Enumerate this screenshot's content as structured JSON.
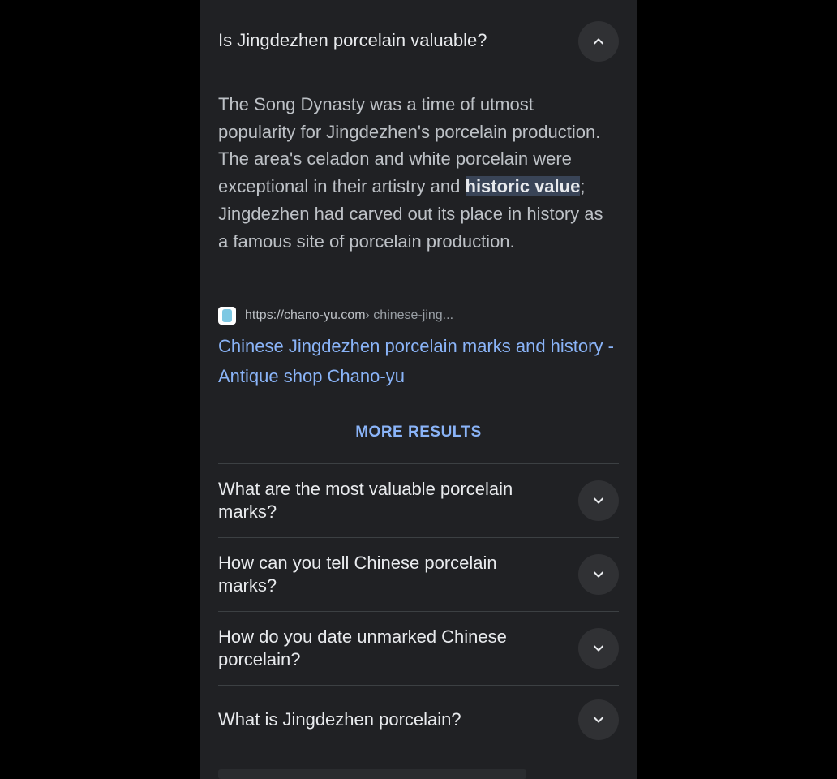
{
  "expanded_question": {
    "title": "Is Jingdezhen porcelain valuable?",
    "answer_before": "The Song Dynasty was a time of utmost popularity for Jingdezhen's porcelain production. The area's celadon and white porcelain were exceptional in their artistry and ",
    "answer_highlight": "historic value",
    "answer_after": "; Jingdezhen had carved out its place in history as a famous site of porcelain production.",
    "source_url": "https://chano-yu.com",
    "source_path": " › chinese-jing...",
    "link_title": "Chinese Jingdezhen porcelain marks and history - Antique shop Chano-yu",
    "collapse_icon": "chevron-up-icon"
  },
  "more_results_label": "MORE RESULTS",
  "questions": [
    {
      "label": "What are the most valuable porcelain marks?",
      "icon": "chevron-down-icon"
    },
    {
      "label": "How can you tell Chinese porcelain marks?",
      "icon": "chevron-down-icon"
    },
    {
      "label": "How do you date unmarked Chinese porcelain?",
      "icon": "chevron-down-icon"
    },
    {
      "label": "What is Jingdezhen porcelain?",
      "icon": "chevron-down-icon"
    }
  ],
  "colors": {
    "background": "#202124",
    "text": "#e8eaed",
    "body_text": "#bdc1c6",
    "link": "#8ab4f8",
    "highlight": "#394457",
    "divider": "#3c4043"
  }
}
